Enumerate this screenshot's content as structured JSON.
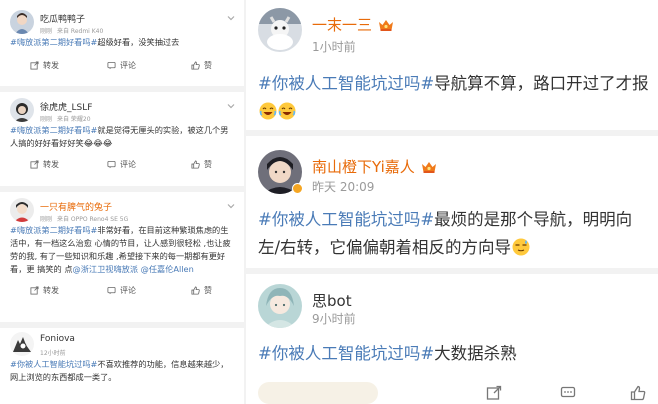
{
  "left_posts": [
    {
      "username": "吃瓜鸭鸭子",
      "meta_time": "刚刚",
      "meta_from": "来自 Redmi K40",
      "hashtag": "#嗨放派第二期好看吗#",
      "body": "超级好看，没笑抽过去",
      "actions": {
        "repost": "转发",
        "comment": "评论",
        "like": "赞"
      }
    },
    {
      "username": "徐虎虎_LSLF",
      "meta_time": "刚刚",
      "meta_from": "来自 荣耀20",
      "hashtag": "#嗨放派第二期好看吗#",
      "body": "就是觉得无厘头的实验，被这几个男人搞的好好看好好笑😂😂😂",
      "actions": {
        "repost": "转发",
        "comment": "评论",
        "like": "赞"
      }
    },
    {
      "username": "一只有脾气的兔子",
      "meta_time": "刚刚",
      "meta_from": "来自 OPPO Reno4 SE 5G",
      "hashtag": "#嗨放派第二期好看吗#",
      "body": "非常好看，在目前这种繁琐焦虑的生活中，有一档这么治愈 心情的节目，让人感到很轻松 ,也让疲劳的我, 有了一些知识和乐趣 ,希望接下来的每一期都有更好看，更 搞笑的 点",
      "mention1": "@浙江卫视嗨放派",
      "mention2": "@任嘉伦Allen",
      "actions": {
        "repost": "转发",
        "comment": "评论",
        "like": "赞"
      }
    },
    {
      "username": "Foniova",
      "meta_time": "12小时前",
      "hashtag": "#你被人工智能坑过吗#",
      "body": "不喜欢推荐的功能，信息越来越少，网上浏览的东西都成一类了。"
    }
  ],
  "right_posts": [
    {
      "username": "一末一三",
      "time": "1小时前",
      "hashtag": "#你被人工智能坑过吗#",
      "body": "导航算不算，路口开过了才报"
    },
    {
      "username": "南山橙下Yi嘉人",
      "time": "昨天 20:09",
      "hashtag": "#你被人工智能坑过吗#",
      "body": "最烦的是那个导航，明明向左/右转，它偏偏朝着相反的方向导"
    },
    {
      "username": "思bot",
      "time": "9小时前",
      "hashtag": "#你被人工智能坑过吗#",
      "body": "大数据杀熟"
    }
  ],
  "icons": [
    "chevron-down-icon",
    "repost-icon",
    "comment-icon",
    "like-icon",
    "crown-badge-icon",
    "laugh-emoji-icon",
    "sweat-emoji-icon",
    "verified-badge-icon"
  ],
  "colors": {
    "hashtag": "#4a7bb7",
    "orange_name": "#e86b0a",
    "meta": "#9a9a9a",
    "separator": "#f2f2f2"
  }
}
